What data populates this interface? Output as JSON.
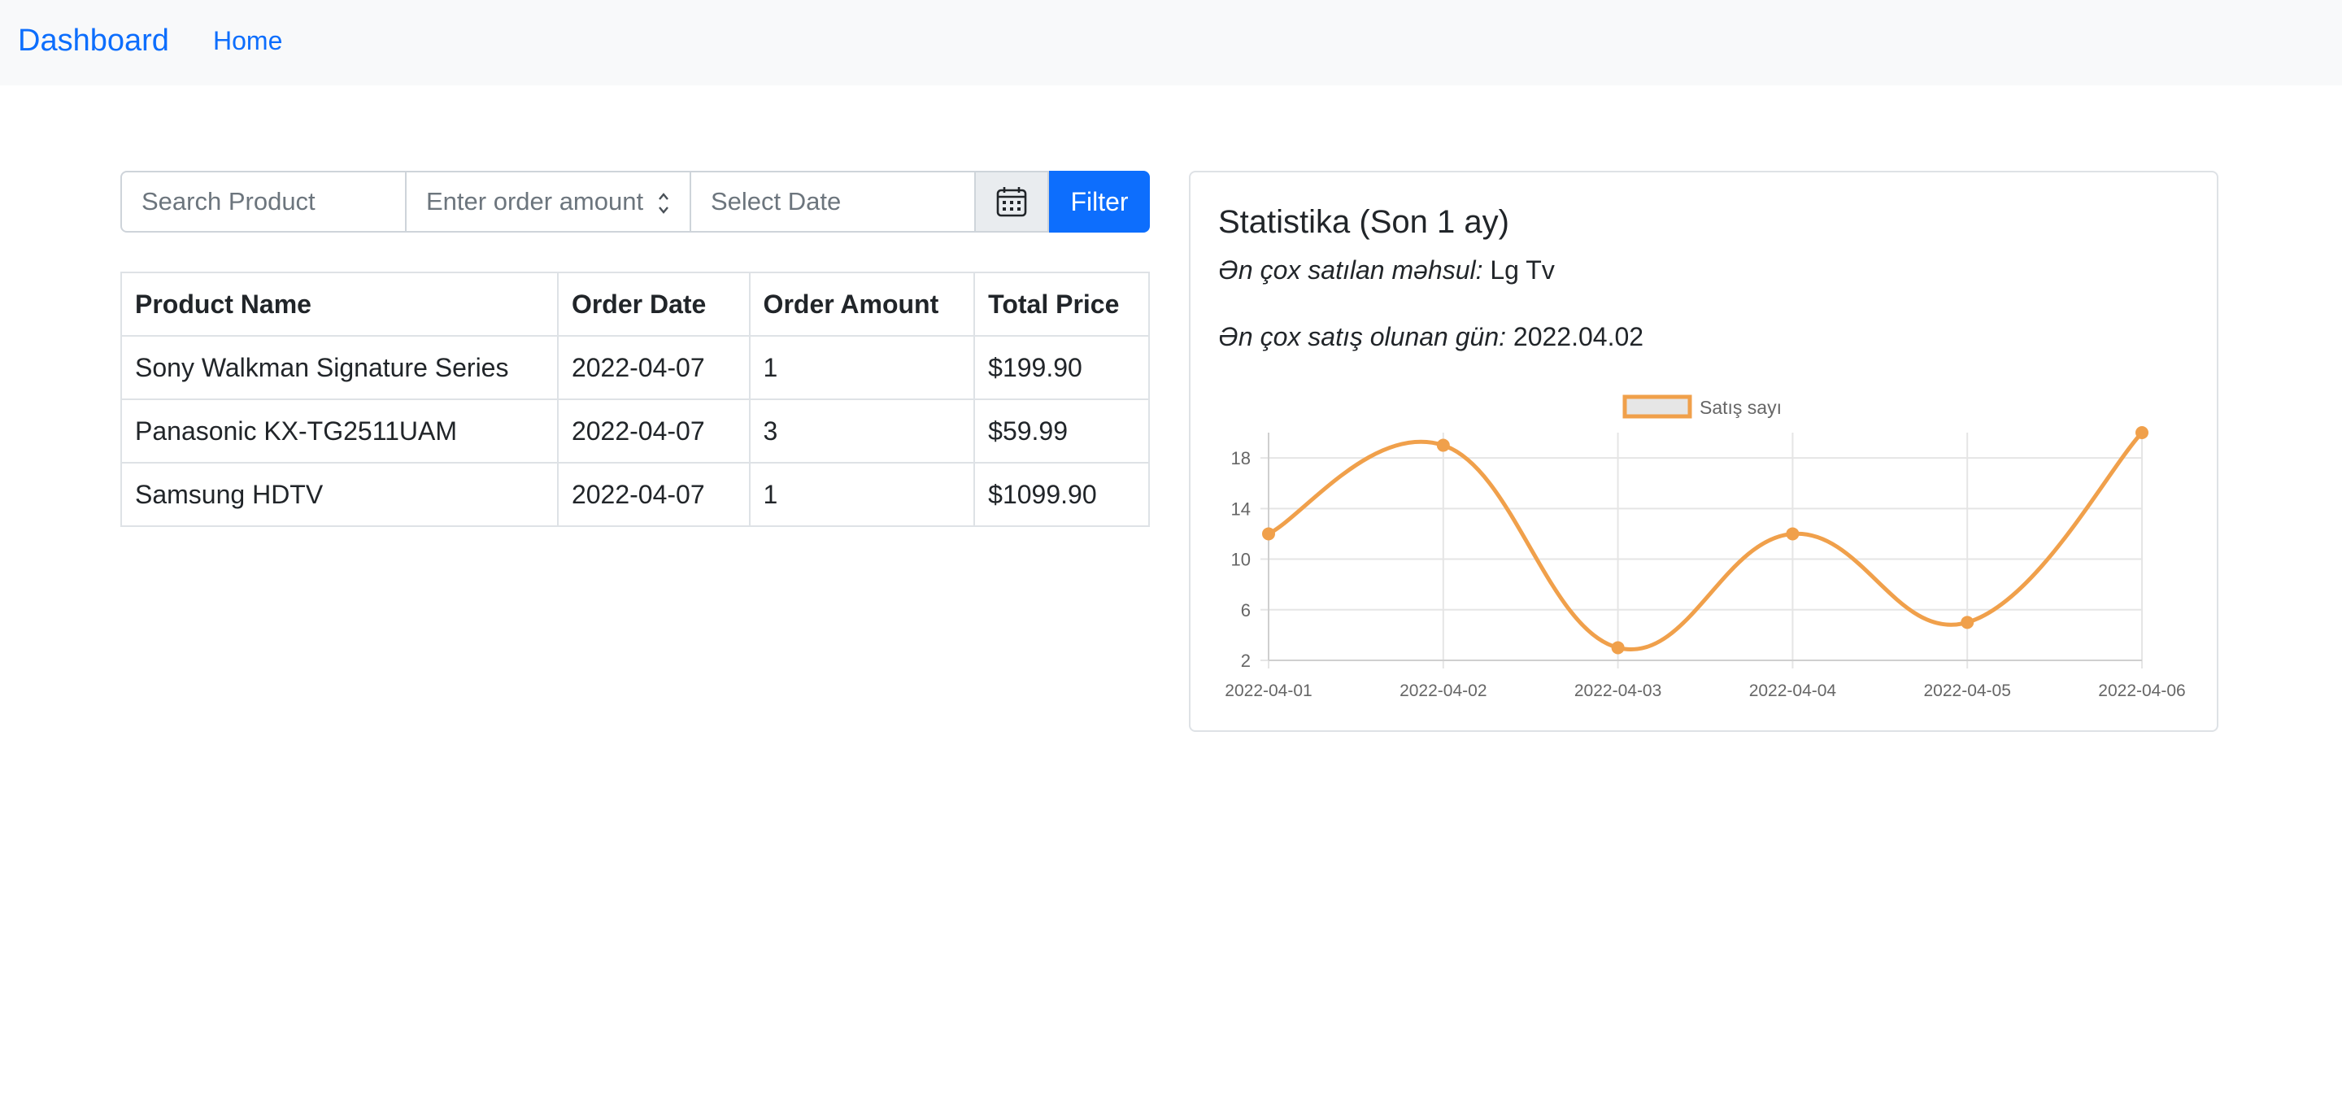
{
  "navbar": {
    "brand": "Dashboard",
    "home": "Home"
  },
  "filters": {
    "search_placeholder": "Search Product",
    "amount_placeholder": "Enter order amount",
    "date_placeholder": "Select Date",
    "filter_label": "Filter"
  },
  "table": {
    "headers": [
      "Product Name",
      "Order Date",
      "Order Amount",
      "Total Price"
    ],
    "rows": [
      [
        "Sony Walkman Signature Series",
        "2022-04-07",
        "1",
        "$199.90"
      ],
      [
        "Panasonic KX-TG2511UAM",
        "2022-04-07",
        "3",
        "$59.99"
      ],
      [
        "Samsung HDTV",
        "2022-04-07",
        "1",
        "$1099.90"
      ]
    ]
  },
  "stats": {
    "title": "Statistika (Son 1 ay)",
    "top_product_label": "Ən çox satılan məhsul:",
    "top_product_value": "Lg Tv",
    "top_day_label": "Ən çox satış olunan gün:",
    "top_day_value": "2022.04.02"
  },
  "colors": {
    "accent": "#0d6efd",
    "line": "#f0a04b",
    "legend_fill": "#e6e6e6",
    "grid": "#e5e5e5"
  },
  "icons": {
    "date_button": "calendar-icon"
  },
  "chart_data": {
    "type": "line",
    "categories": [
      "2022-04-01",
      "2022-04-02",
      "2022-04-03",
      "2022-04-04",
      "2022-04-05",
      "2022-04-06"
    ],
    "series": [
      {
        "name": "Satış sayı",
        "values": [
          12,
          19,
          3,
          12,
          5,
          20
        ]
      }
    ],
    "yticks": [
      2,
      6,
      10,
      14,
      18
    ],
    "ylim": [
      2,
      20
    ],
    "grid": true,
    "legend": "top"
  }
}
